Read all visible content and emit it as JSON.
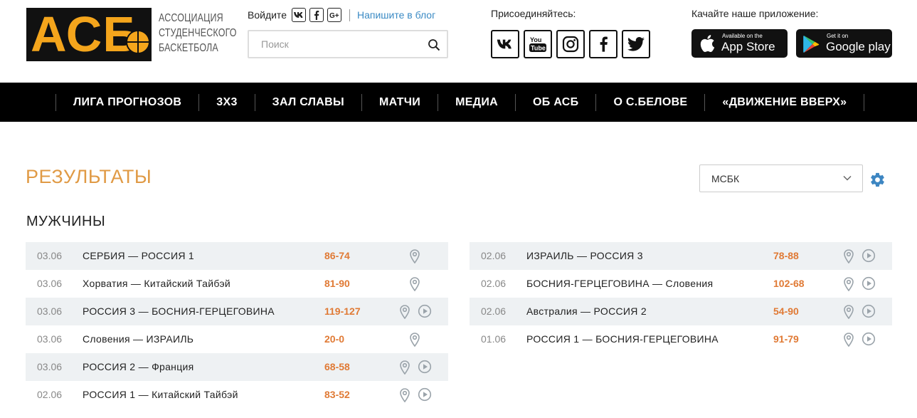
{
  "logo": {
    "letters": "АСБ",
    "text_line1": "АССОЦИАЦИЯ",
    "text_line2": "СТУДЕНЧЕСКОГО",
    "text_line3": "БАСКЕТБОЛА"
  },
  "header": {
    "login_label": "Войдите",
    "login_icons": [
      "vk-icon",
      "facebook-icon",
      "google-plus-icon"
    ],
    "blog_link": "Напишите в блог",
    "search_placeholder": "Поиск",
    "join_label": "Присоединяйтесь:",
    "join_icons": [
      "vk-icon",
      "youtube-icon",
      "instagram-icon",
      "facebook-icon",
      "twitter-icon"
    ],
    "app_label": "Качайте наше приложение:",
    "appstore_small": "Available on the",
    "appstore_big": "App Store",
    "googleplay_small": "Get it on",
    "googleplay_big": "Google play"
  },
  "nav": {
    "items": [
      "ЛИГА ПРОГНОЗОВ",
      "3Х3",
      "ЗАЛ СЛАВЫ",
      "МАТЧИ",
      "МЕДИА",
      "ОБ АСБ",
      "О С.БЕЛОВЕ",
      "«ДВИЖЕНИЕ ВВЕРХ»"
    ]
  },
  "main": {
    "title": "РЕЗУЛЬТАТЫ",
    "select_value": "МСБК",
    "section_title": "МУЖЧИНЫ",
    "accent_color": "#e07a35",
    "left_results": [
      {
        "date": "03.06",
        "teams": "СЕРБИЯ — РОССИЯ 1",
        "score": "86-74",
        "video": false
      },
      {
        "date": "03.06",
        "teams": "Хорватия — Китайский Тайбэй",
        "score": "81-90",
        "video": false
      },
      {
        "date": "03.06",
        "teams": "РОССИЯ 3 — БОСНИЯ-ГЕРЦЕГОВИНА",
        "score": "119-127",
        "video": true
      },
      {
        "date": "03.06",
        "teams": "Словения — ИЗРАИЛЬ",
        "score": "20-0",
        "video": false
      },
      {
        "date": "03.06",
        "teams": "РОССИЯ 2 — Франция",
        "score": "68-58",
        "video": true
      },
      {
        "date": "02.06",
        "teams": "РОССИЯ 1 — Китайский Тайбэй",
        "score": "83-52",
        "video": true
      }
    ],
    "right_results": [
      {
        "date": "02.06",
        "teams": "ИЗРАИЛЬ — РОССИЯ 3",
        "score": "78-88",
        "video": true
      },
      {
        "date": "02.06",
        "teams": "БОСНИЯ-ГЕРЦЕГОВИНА — Словения",
        "score": "102-68",
        "video": true
      },
      {
        "date": "02.06",
        "teams": "Австралия — РОССИЯ 2",
        "score": "54-90",
        "video": true
      },
      {
        "date": "01.06",
        "teams": "РОССИЯ 1 — БОСНИЯ-ГЕРЦЕГОВИНА",
        "score": "91-79",
        "video": true
      }
    ]
  }
}
